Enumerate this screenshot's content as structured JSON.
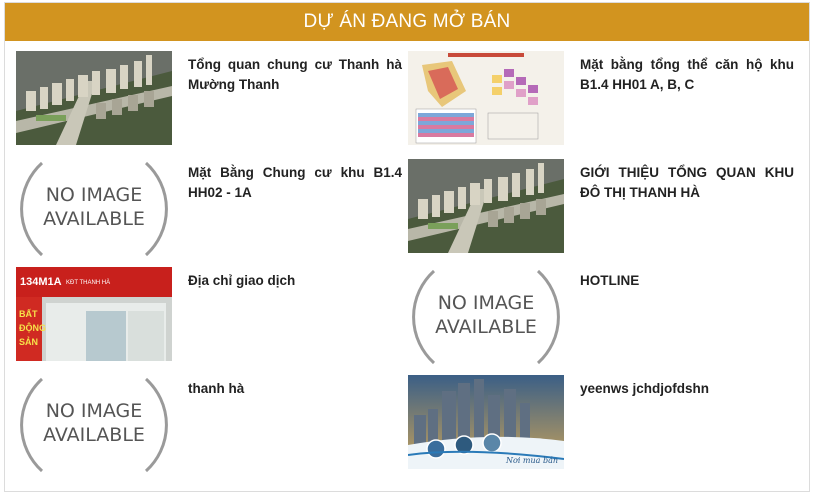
{
  "header": {
    "title": "DỰ ÁN ĐANG MỞ BÁN"
  },
  "no_image_text": {
    "line1": "NO IMAGE",
    "line2": "AVAILABLE"
  },
  "items": [
    {
      "title": "Tổng quan chung cư Thanh hà Mường Thanh",
      "thumb": "masterplan-aerial"
    },
    {
      "title": "Mặt bằng tổng thể căn hộ khu B1.4 HH01 A, B, C",
      "thumb": "floorplan"
    },
    {
      "title": "Mặt Bằng Chung cư khu B1.4 HH02 - 1A",
      "thumb": "no-image"
    },
    {
      "title": "GIỚI THIỆU TỔNG QUAN KHU ĐÔ THỊ THANH HÀ",
      "thumb": "masterplan-aerial"
    },
    {
      "title": "Địa chỉ giao dịch",
      "thumb": "storefront",
      "sign_text": "134M1A",
      "sign_sub": "KĐT THANH HÀ",
      "banner_text": "BẤT ĐỘNG SẢN"
    },
    {
      "title": "HOTLINE",
      "thumb": "no-image"
    },
    {
      "title": "thanh hà",
      "thumb": "no-image"
    },
    {
      "title": "yeenws jchdjofdshn",
      "thumb": "towers-promo",
      "promo_text": "Nơi mua bán"
    }
  ]
}
